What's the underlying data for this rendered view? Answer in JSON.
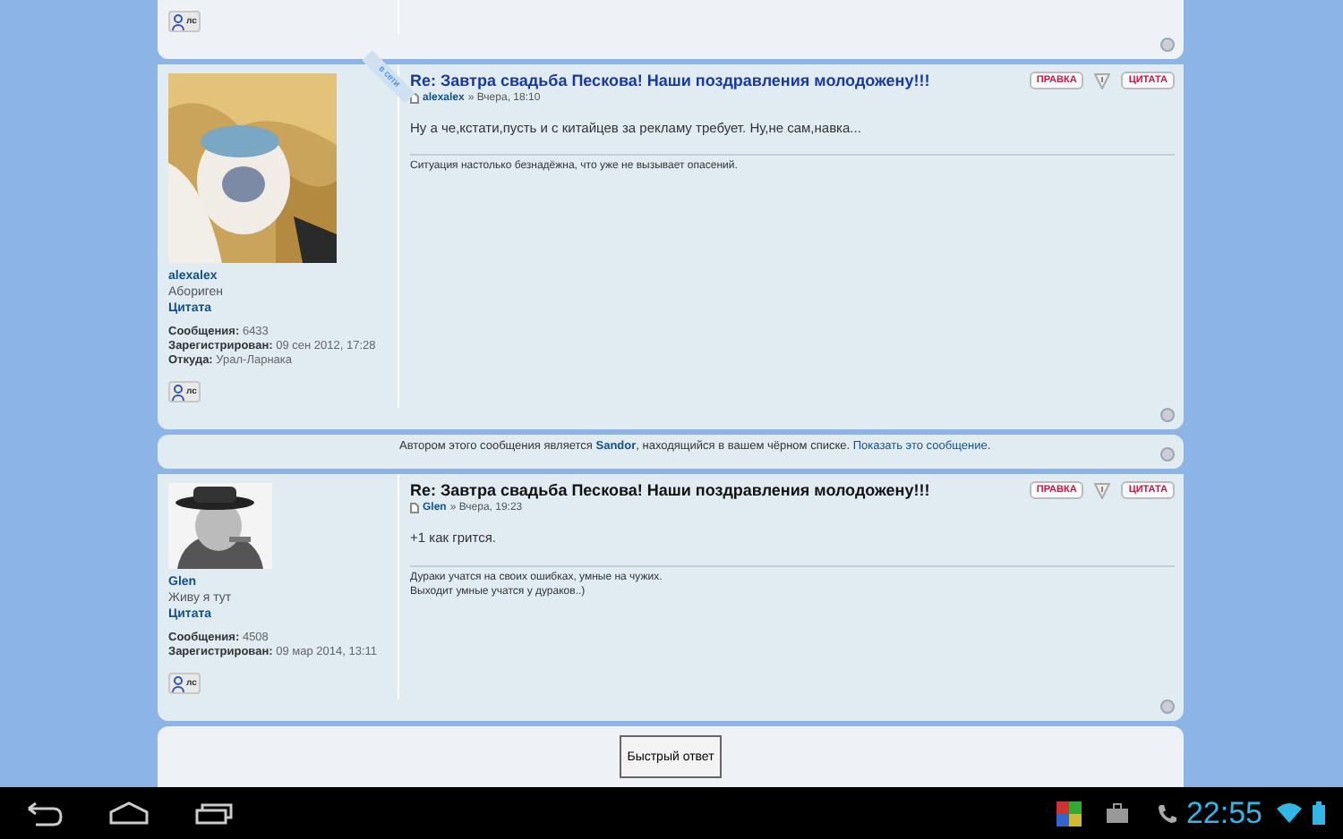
{
  "previous_post_tail": {
    "pm_button": "лс"
  },
  "posts": [
    {
      "kind": "post",
      "online": true,
      "online_label": "в сети",
      "avatar": {
        "kind": "picture"
      },
      "author": "alexalex",
      "rank": "Абориген",
      "quote_link": "Цитата",
      "stats": [
        {
          "label": "Сообщения:",
          "value": "6433"
        },
        {
          "label": "Зарегистрирован:",
          "value": "09 сен 2012, 17:28"
        },
        {
          "label": "Откуда:",
          "value": "Урал-Ларнака"
        }
      ],
      "pm_button": "лс",
      "title": "Re: Завтра свадьба Пескова! Наши поздравления молодожену!!!",
      "title_visited": false,
      "meta_author": "alexalex",
      "meta_sep": "»",
      "meta_time": "Вчера, 18:10",
      "edit_button": "ПРАВКА",
      "quote_button": "ЦИТАТА",
      "body": "Ну а че,кстати,пусть и с китайцев за рекламу требует. Ну,не сам,навка...",
      "signature": [
        "Ситуация настолько безнадёжна, что уже не вызывает опасений."
      ]
    },
    {
      "kind": "blacklisted",
      "before": "Автором этого сообщения является ",
      "author": "Sandor",
      "middle": ", находящийся в вашем чёрном списке. ",
      "link": "Показать это сообщение",
      "after": "."
    },
    {
      "kind": "post",
      "online": false,
      "avatar": {
        "kind": "picture"
      },
      "author": "Glen",
      "rank": "Живу я тут",
      "quote_link": "Цитата",
      "stats": [
        {
          "label": "Сообщения:",
          "value": "4508"
        },
        {
          "label": "Зарегистрирован:",
          "value": "09 мар 2014, 13:11"
        }
      ],
      "pm_button": "лс",
      "title": "Re: Завтра свадьба Пескова! Наши поздравления молодожену!!!",
      "title_visited": true,
      "meta_author": "Glen",
      "meta_sep": "»",
      "meta_time": "Вчера, 19:23",
      "edit_button": "ПРАВКА",
      "quote_button": "ЦИТАТА",
      "body": "+1 как грится.",
      "signature": [
        "Дураки учатся на своих ошибках, умные на чужих.",
        "Выходит умные учатся у дураков..)"
      ]
    }
  ],
  "quick_reply_button": "Быстрый ответ",
  "status_bar": {
    "time": "22:55"
  }
}
